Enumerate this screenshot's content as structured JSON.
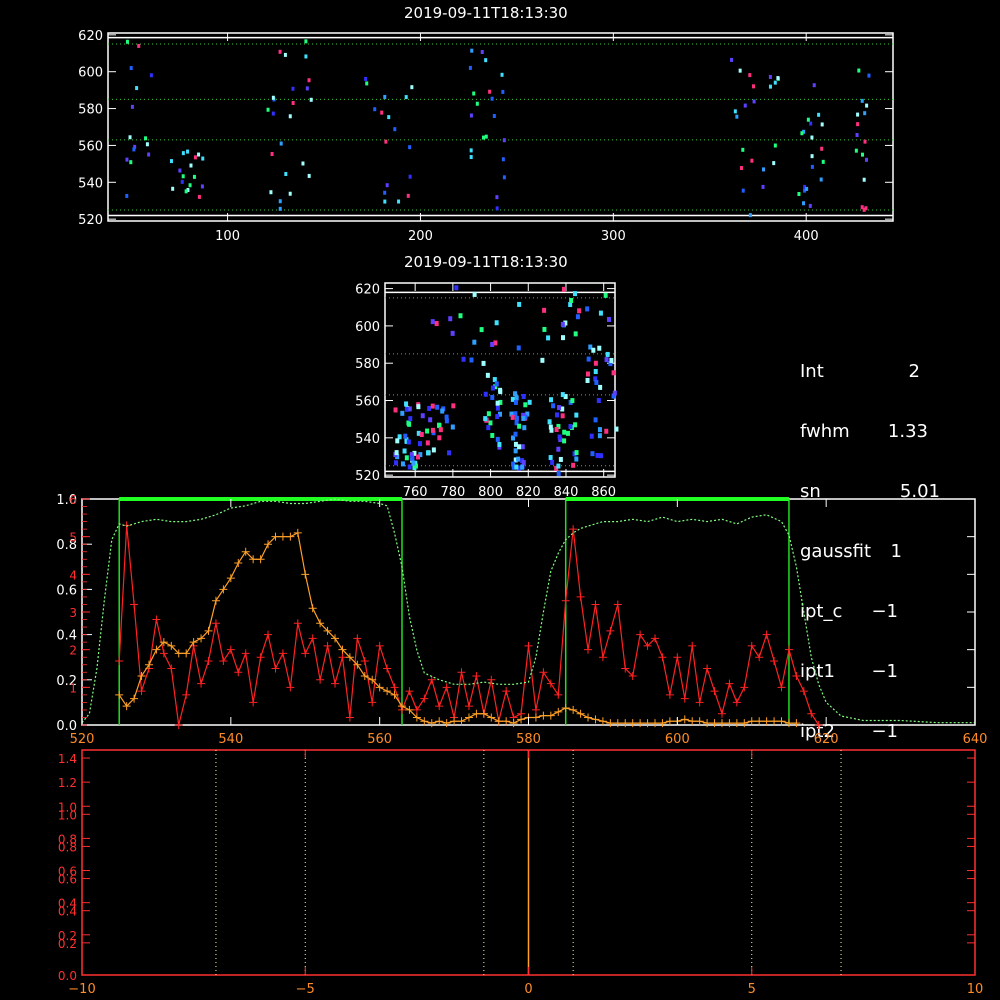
{
  "chart_data": [
    {
      "type": "heatmap",
      "title": "2019-09-11T18:13:30",
      "xlim": [
        38,
        445
      ],
      "ylim": [
        519,
        621
      ],
      "x_ticks": [
        "100",
        "200",
        "300",
        "400"
      ],
      "x_tick_values": [
        100,
        200,
        300,
        400
      ],
      "y_ticks": [
        "520",
        "540",
        "560",
        "580",
        "600",
        "620"
      ],
      "y_tick_values": [
        520,
        540,
        560,
        580,
        600,
        620
      ],
      "reference_lines_y": [
        615,
        585,
        563,
        525
      ],
      "grid": false
    },
    {
      "type": "heatmap",
      "title": "2019-09-11T18:13:30",
      "xlim": [
        744,
        866
      ],
      "ylim": [
        519,
        623
      ],
      "x_ticks": [
        "760",
        "780",
        "800",
        "820",
        "840",
        "860"
      ],
      "x_tick_values": [
        760,
        780,
        800,
        820,
        840,
        860
      ],
      "y_ticks": [
        "520",
        "540",
        "560",
        "580",
        "600",
        "620"
      ],
      "y_tick_values": [
        520,
        540,
        560,
        580,
        600,
        620
      ],
      "reference_lines_y": [
        615,
        585,
        563,
        525
      ],
      "grid": false
    },
    {
      "type": "line",
      "xlim": [
        520,
        640
      ],
      "ylim": [
        0,
        1.0
      ],
      "x_ticks": [
        "520",
        "540",
        "560",
        "580",
        "600",
        "620",
        "640"
      ],
      "x_tick_values": [
        520,
        540,
        560,
        580,
        600,
        620,
        640
      ],
      "y_ticks": [
        "0.0",
        "0.2",
        "0.4",
        "0.6",
        "0.8",
        "1.0"
      ],
      "y_tick_values": [
        0,
        0.2,
        0.4,
        0.6,
        0.8,
        1.0
      ],
      "right_ticks": [
        "1",
        "2",
        "3",
        "4",
        "5",
        "6"
      ],
      "right_tick_values": [
        1,
        2,
        3,
        4,
        5,
        6
      ],
      "right_ylim": [
        0,
        6
      ],
      "windows": [
        [
          525,
          563
        ],
        [
          585,
          615
        ]
      ],
      "series": [
        {
          "color": "#ff2222",
          "marker": "+",
          "axis": "right",
          "x": [
            525,
            526,
            527,
            528,
            529,
            530,
            531,
            532,
            533,
            534,
            535,
            536,
            537,
            538,
            539,
            540,
            541,
            542,
            543,
            544,
            545,
            546,
            547,
            548,
            549,
            550,
            551,
            552,
            553,
            554,
            555,
            556,
            557,
            558,
            559,
            560,
            561,
            562,
            563,
            564,
            565,
            566,
            567,
            568,
            569,
            570,
            571,
            572,
            573,
            574,
            575,
            576,
            577,
            578,
            579,
            580,
            581,
            582,
            583,
            584,
            585,
            586,
            587,
            588,
            589,
            590,
            591,
            592,
            593,
            594,
            595,
            596,
            597,
            598,
            599,
            600,
            601,
            602,
            603,
            604,
            605,
            606,
            607,
            608,
            609,
            610,
            611,
            612,
            613,
            614,
            615,
            616,
            617,
            618,
            619
          ],
          "y": [
            1.7,
            5.3,
            3.2,
            0.9,
            1.5,
            2.8,
            1.9,
            1.5,
            0,
            0.8,
            2.1,
            1.1,
            1.7,
            2.7,
            1.7,
            2,
            1.4,
            1.9,
            0.6,
            1.8,
            2.4,
            1.5,
            1.9,
            1,
            2.7,
            1.9,
            2.3,
            1.2,
            2.1,
            1.1,
            1.8,
            0.2,
            2.3,
            1.7,
            0.6,
            2.1,
            1.5,
            1,
            0.4,
            0.9,
            0.4,
            0.7,
            1.2,
            0.5,
            1,
            0.2,
            1.4,
            0.5,
            1.3,
            0.3,
            1.2,
            0.1,
            0.9,
            0.2,
            0.3,
            2.1,
            0.4,
            1.4,
            1.1,
            0.8,
            3.3,
            5.2,
            3.4,
            2,
            3.2,
            1.8,
            2.5,
            3.2,
            1.5,
            1.3,
            2.4,
            2.1,
            2.3,
            1.8,
            0.8,
            1.8,
            0.7,
            2.1,
            0.6,
            1.5,
            0.9,
            0.3,
            1.1,
            0.6,
            1,
            2.1,
            1.8,
            2.4,
            1.7,
            1,
            2,
            1.3,
            0.9,
            0.3,
            0
          ]
        },
        {
          "color": "#ffa028",
          "marker": "+",
          "axis": "right",
          "x": [
            525,
            526,
            527,
            528,
            529,
            530,
            531,
            532,
            533,
            534,
            535,
            536,
            537,
            538,
            539,
            540,
            541,
            542,
            543,
            544,
            545,
            546,
            547,
            548,
            549,
            550,
            551,
            552,
            553,
            554,
            555,
            556,
            557,
            558,
            559,
            560,
            561,
            562,
            563,
            564,
            565,
            566,
            567,
            568,
            569,
            570,
            571,
            572,
            573,
            574,
            575,
            576,
            577,
            578,
            579,
            580,
            581,
            582,
            583,
            584,
            585,
            586,
            587,
            588,
            589,
            590,
            591,
            592,
            593,
            594,
            595,
            596,
            597,
            598,
            599,
            600,
            601,
            602,
            603,
            604,
            605,
            606,
            607,
            608,
            609,
            610,
            611,
            612,
            613,
            614,
            615,
            616
          ],
          "y": [
            0.8,
            0.5,
            0.7,
            1.3,
            1.6,
            2,
            2.2,
            2.1,
            1.9,
            1.9,
            2.2,
            2.3,
            2.5,
            3.3,
            3.6,
            3.9,
            4.3,
            4.6,
            4.4,
            4.4,
            4.8,
            5,
            5,
            5,
            5.1,
            4,
            3.1,
            2.7,
            2.5,
            2.3,
            2,
            1.8,
            1.6,
            1.3,
            1.2,
            1,
            0.9,
            0.8,
            0.5,
            0.4,
            0.2,
            0.1,
            0.05,
            0.1,
            0.05,
            0.1,
            0.1,
            0.2,
            0.3,
            0.3,
            0.2,
            0.1,
            0.1,
            0.05,
            0.15,
            0.2,
            0.2,
            0.25,
            0.25,
            0.35,
            0.45,
            0.4,
            0.3,
            0.2,
            0.15,
            0.1,
            0.05,
            0.05,
            0.05,
            0.05,
            0.05,
            0.05,
            0.05,
            0.05,
            0.1,
            0.1,
            0.15,
            0.1,
            0.1,
            0.05,
            0.05,
            0.05,
            0.05,
            0.05,
            0.05,
            0.1,
            0.1,
            0.1,
            0.1,
            0.1,
            0.05,
            0.05
          ]
        },
        {
          "color": "#80ff80",
          "dashed": true,
          "axis": "left",
          "x": [
            520,
            521,
            522,
            523,
            524,
            525,
            526,
            527,
            528,
            530,
            532,
            534,
            536,
            538,
            540,
            542,
            544,
            546,
            548,
            550,
            552,
            554,
            556,
            558,
            560,
            561,
            562,
            563,
            564,
            565,
            566,
            568,
            570,
            572,
            574,
            576,
            578,
            580,
            581,
            582,
            583,
            584,
            585,
            586,
            587,
            588,
            590,
            592,
            594,
            596,
            598,
            600,
            602,
            604,
            606,
            608,
            610,
            612,
            614,
            615,
            616,
            617,
            618,
            619,
            620,
            622,
            625,
            630,
            635,
            640
          ],
          "y": [
            0.01,
            0.05,
            0.25,
            0.55,
            0.82,
            0.89,
            0.88,
            0.89,
            0.9,
            0.91,
            0.9,
            0.9,
            0.91,
            0.93,
            0.96,
            0.97,
            0.99,
            0.99,
            0.98,
            0.98,
            0.99,
            1.0,
            0.99,
            0.99,
            0.98,
            0.97,
            0.85,
            0.7,
            0.48,
            0.33,
            0.23,
            0.2,
            0.18,
            0.18,
            0.19,
            0.18,
            0.18,
            0.19,
            0.3,
            0.5,
            0.68,
            0.76,
            0.82,
            0.85,
            0.87,
            0.88,
            0.9,
            0.9,
            0.91,
            0.9,
            0.92,
            0.9,
            0.91,
            0.9,
            0.91,
            0.89,
            0.92,
            0.93,
            0.9,
            0.84,
            0.7,
            0.5,
            0.3,
            0.18,
            0.1,
            0.04,
            0.02,
            0.02,
            0.01,
            0.01
          ]
        }
      ],
      "grid": false
    },
    {
      "type": "line",
      "xlim": [
        -10,
        10
      ],
      "ylim": [
        0,
        1.4
      ],
      "x_ticks": [
        "−10",
        "−5",
        "0",
        "5",
        "10"
      ],
      "x_tick_values": [
        -10,
        -5,
        0,
        5,
        10
      ],
      "y_ticks": [
        "0.0",
        "0.2",
        "0.2",
        "0.4",
        "0.4",
        "0.6",
        "0.6",
        "0.8",
        "0.8",
        "1.0",
        "1.0",
        "1.2",
        "1.4"
      ],
      "y_tick_values": [
        0,
        0.2,
        0.25,
        0.4,
        0.45,
        0.6,
        0.65,
        0.8,
        0.85,
        1.0,
        1.05,
        1.2,
        1.35
      ],
      "vertical_lines_x": [
        -7,
        -5,
        -1,
        1,
        5,
        7
      ],
      "center_line_x": 0,
      "grid": false
    }
  ],
  "info": {
    "rows": [
      {
        "label": "Int",
        "value": "2"
      },
      {
        "label": "fwhm",
        "value": "1.33"
      },
      {
        "label": "sn",
        "value": "5.01"
      },
      {
        "label": "gaussfit",
        "value": "1"
      },
      {
        "label": "ipt_c",
        "value": "−1"
      },
      {
        "label": "ipt1",
        "value": "−1"
      },
      {
        "label": "ipt2",
        "value": "−1"
      }
    ]
  }
}
